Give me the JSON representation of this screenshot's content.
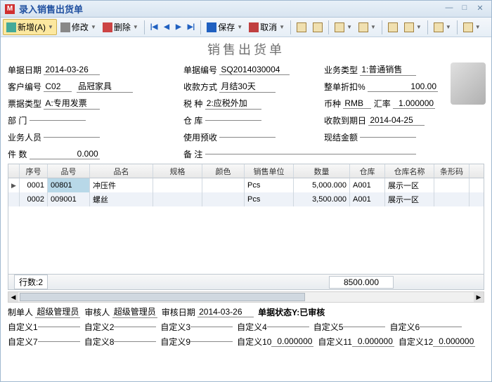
{
  "window": {
    "title": "录入销售出货单"
  },
  "toolbar": {
    "new_label": "新增(A)",
    "edit_label": "修改",
    "delete_label": "删除",
    "save_label": "保存",
    "cancel_label": "取消"
  },
  "doc_title": "销售出货单",
  "form": {
    "billdate_lbl": "单据日期",
    "billdate": "2014-03-26",
    "billno_lbl": "单据编号",
    "billno": "SQ2014030004",
    "biztype_lbl": "业务类型",
    "biztype": "1:普通销售",
    "cust_lbl": "客户编号",
    "cust_code": "C02",
    "cust_name": "品冠家具",
    "paymode_lbl": "收款方式",
    "paymode": "月结30天",
    "discount_lbl": "整单折扣%",
    "discount": "100.00",
    "invtype_lbl": "票据类型",
    "invtype": "A:专用发票",
    "tax_lbl": "税      种",
    "tax": "2:应税外加",
    "currency_lbl": "币种",
    "currency": "RMB",
    "rate_lbl": "汇率",
    "rate": "1.000000",
    "dept_lbl": "部      门",
    "dept": "",
    "wh_lbl": "仓      库",
    "wh": "",
    "duedate_lbl": "收款到期日",
    "duedate": "2014-04-25",
    "sales_lbl": "业务人员",
    "sales": "",
    "prepay_lbl": "使用预收",
    "prepay": "",
    "cash_lbl": "现结金额",
    "cash": "",
    "pcs_lbl": "件      数",
    "pcs": "0.000",
    "remark_lbl": "备      注",
    "remark": ""
  },
  "grid": {
    "headers": {
      "seq": "序号",
      "pno": "品号",
      "pname": "品名",
      "spec": "规格",
      "color": "颜色",
      "unit": "销售单位",
      "qty": "数量",
      "wh": "仓库",
      "whn": "仓库名称",
      "bar": "条形码"
    },
    "rows": [
      {
        "seq": "0001",
        "pno": "00801",
        "pname": "冲压件",
        "spec": "",
        "color": "",
        "unit": "Pcs",
        "qty": "5,000.000",
        "wh": "A001",
        "whn": "展示一区",
        "bar": ""
      },
      {
        "seq": "0002",
        "pno": "009001",
        "pname": "螺丝",
        "spec": "",
        "color": "",
        "unit": "Pcs",
        "qty": "3,500.000",
        "wh": "A001",
        "whn": "展示一区",
        "bar": ""
      }
    ],
    "row_count_lbl": "行数:2",
    "total_qty": "8500.000"
  },
  "bottom": {
    "maker_lbl": "制单人",
    "maker": "超级管理员",
    "auditor_lbl": "审核人",
    "auditor": "超级管理员",
    "auditdate_lbl": "审核日期",
    "auditdate": "2014-03-26",
    "status_lbl": "单据状态",
    "status": "Y:已审核",
    "c1_lbl": "自定义1",
    "c1": "",
    "c2_lbl": "自定义2",
    "c2": "",
    "c3_lbl": "自定义3",
    "c3": "",
    "c4_lbl": "自定义4",
    "c4": "",
    "c5_lbl": "自定义5",
    "c5": "",
    "c6_lbl": "自定义6",
    "c6": "",
    "c7_lbl": "自定义7",
    "c7": "",
    "c8_lbl": "自定义8",
    "c8": "",
    "c9_lbl": "自定义9",
    "c9": "",
    "c10_lbl": "自定义10",
    "c10": "0.000000",
    "c11_lbl": "自定义11",
    "c11": "0.000000",
    "c12_lbl": "自定义12",
    "c12": "0.000000"
  }
}
